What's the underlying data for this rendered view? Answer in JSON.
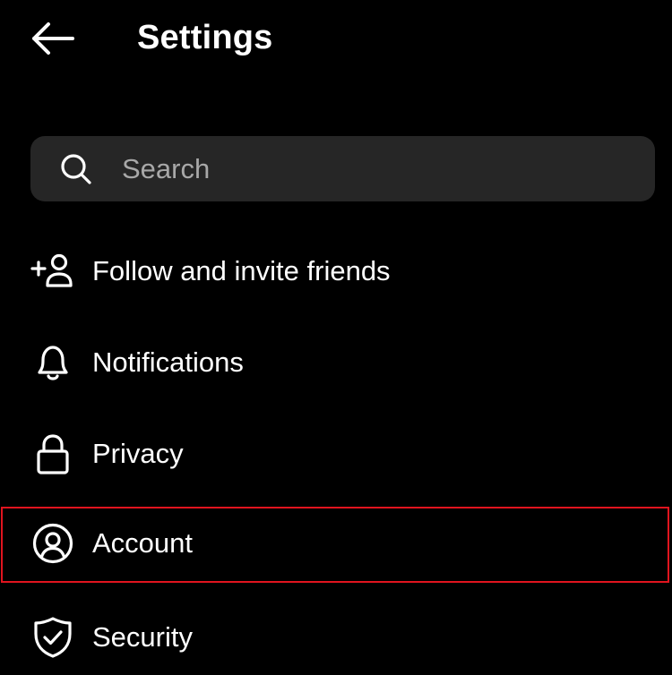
{
  "header": {
    "back_icon": "arrow-left-icon",
    "title": "Settings"
  },
  "search": {
    "icon": "search-icon",
    "placeholder": "Search"
  },
  "menu": {
    "items": [
      {
        "icon": "add-person-icon",
        "label": "Follow and invite friends"
      },
      {
        "icon": "bell-icon",
        "label": "Notifications"
      },
      {
        "icon": "lock-icon",
        "label": "Privacy"
      },
      {
        "icon": "user-circle-icon",
        "label": "Account"
      },
      {
        "icon": "shield-check-icon",
        "label": "Security"
      }
    ]
  },
  "highlighted_item": "Account",
  "colors": {
    "background": "#000000",
    "text": "#ffffff",
    "search_background": "#262626",
    "placeholder": "#a8a8a8",
    "highlight_border": "#e0141e"
  }
}
